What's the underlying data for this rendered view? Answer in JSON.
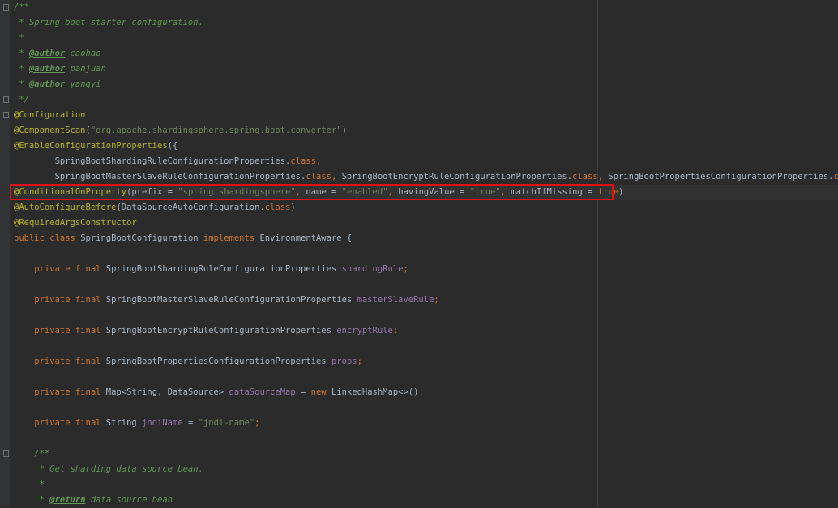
{
  "editor": {
    "lines": [
      {
        "tokens": [
          {
            "t": "/**",
            "k": "c"
          }
        ]
      },
      {
        "tokens": [
          {
            "t": " * Spring boot starter configuration.",
            "k": "c"
          }
        ]
      },
      {
        "tokens": [
          {
            "t": " *",
            "k": "c"
          }
        ]
      },
      {
        "tokens": [
          {
            "t": " * ",
            "k": "c"
          },
          {
            "t": "@author",
            "k": "tag"
          },
          {
            "t": " caohao",
            "k": "c"
          }
        ]
      },
      {
        "tokens": [
          {
            "t": " * ",
            "k": "c"
          },
          {
            "t": "@author",
            "k": "tag"
          },
          {
            "t": " panjuan",
            "k": "c"
          }
        ]
      },
      {
        "tokens": [
          {
            "t": " * ",
            "k": "c"
          },
          {
            "t": "@author",
            "k": "tag"
          },
          {
            "t": " yangyi",
            "k": "c"
          }
        ]
      },
      {
        "tokens": [
          {
            "t": " */",
            "k": "c"
          }
        ]
      },
      {
        "tokens": [
          {
            "t": "@Configuration",
            "k": "ann"
          }
        ]
      },
      {
        "tokens": [
          {
            "t": "@ComponentScan",
            "k": "ann"
          },
          {
            "t": "(",
            "k": "pl"
          },
          {
            "t": "\"org.apache.shardingsphere.spring.boot.converter\"",
            "k": "str"
          },
          {
            "t": ")",
            "k": "pl"
          }
        ]
      },
      {
        "tokens": [
          {
            "t": "@EnableConfigurationProperties",
            "k": "ann"
          },
          {
            "t": "({",
            "k": "pl"
          }
        ]
      },
      {
        "tokens": [
          {
            "t": "        SpringBootShardingRuleConfigurationProperties.",
            "k": "pl"
          },
          {
            "t": "class",
            "k": "kw"
          },
          {
            "t": ",",
            "k": "kw"
          }
        ]
      },
      {
        "tokens": [
          {
            "t": "        SpringBootMasterSlaveRuleConfigurationProperties.",
            "k": "pl"
          },
          {
            "t": "class",
            "k": "kw"
          },
          {
            "t": ", ",
            "k": "kw"
          },
          {
            "t": "SpringBootEncryptRuleConfigurationProperties.",
            "k": "pl"
          },
          {
            "t": "class",
            "k": "kw"
          },
          {
            "t": ", ",
            "k": "kw"
          },
          {
            "t": "SpringBootPropertiesConfigurationProperties.",
            "k": "pl"
          },
          {
            "t": "class",
            "k": "kw"
          },
          {
            "t": "})",
            "k": "pl"
          }
        ]
      },
      {
        "tokens": [
          {
            "t": "@ConditionalOnProperty",
            "k": "ann"
          },
          {
            "t": "(prefix = ",
            "k": "pl"
          },
          {
            "t": "\"spring.shardingsphere\"",
            "k": "str"
          },
          {
            "t": ", ",
            "k": "kw"
          },
          {
            "t": "name = ",
            "k": "pl"
          },
          {
            "t": "\"enabled\"",
            "k": "str"
          },
          {
            "t": ", ",
            "k": "kw"
          },
          {
            "t": "havingValue = ",
            "k": "pl"
          },
          {
            "t": "\"true\"",
            "k": "str"
          },
          {
            "t": ", ",
            "k": "kw"
          },
          {
            "t": "matchIfMissing = ",
            "k": "pl"
          },
          {
            "t": "true",
            "k": "kw"
          },
          {
            "t": ")",
            "k": "pl"
          }
        ]
      },
      {
        "tokens": [
          {
            "t": "@AutoConfigureBefore",
            "k": "ann"
          },
          {
            "t": "(DataSourceAutoConfiguration.",
            "k": "pl"
          },
          {
            "t": "class",
            "k": "kw"
          },
          {
            "t": ")",
            "k": "pl"
          }
        ]
      },
      {
        "tokens": [
          {
            "t": "@RequiredArgsConstructor",
            "k": "ann"
          }
        ]
      },
      {
        "tokens": [
          {
            "t": "public class ",
            "k": "kw"
          },
          {
            "t": "SpringBootConfiguration ",
            "k": "pl"
          },
          {
            "t": "implements ",
            "k": "kw"
          },
          {
            "t": "EnvironmentAware {",
            "k": "pl"
          }
        ]
      },
      {
        "tokens": []
      },
      {
        "tokens": [
          {
            "t": "    private final ",
            "k": "kw"
          },
          {
            "t": "SpringBootShardingRuleConfigurationProperties ",
            "k": "pl"
          },
          {
            "t": "shardingRule",
            "k": "fld"
          },
          {
            "t": ";",
            "k": "kw"
          }
        ]
      },
      {
        "tokens": []
      },
      {
        "tokens": [
          {
            "t": "    private final ",
            "k": "kw"
          },
          {
            "t": "SpringBootMasterSlaveRuleConfigurationProperties ",
            "k": "pl"
          },
          {
            "t": "masterSlaveRule",
            "k": "fld"
          },
          {
            "t": ";",
            "k": "kw"
          }
        ]
      },
      {
        "tokens": []
      },
      {
        "tokens": [
          {
            "t": "    private final ",
            "k": "kw"
          },
          {
            "t": "SpringBootEncryptRuleConfigurationProperties ",
            "k": "pl"
          },
          {
            "t": "encryptRule",
            "k": "fld"
          },
          {
            "t": ";",
            "k": "kw"
          }
        ]
      },
      {
        "tokens": []
      },
      {
        "tokens": [
          {
            "t": "    private final ",
            "k": "kw"
          },
          {
            "t": "SpringBootPropertiesConfigurationProperties ",
            "k": "pl"
          },
          {
            "t": "props",
            "k": "fld"
          },
          {
            "t": ";",
            "k": "kw"
          }
        ]
      },
      {
        "tokens": []
      },
      {
        "tokens": [
          {
            "t": "    private final ",
            "k": "kw"
          },
          {
            "t": "Map<String, DataSource> ",
            "k": "pl"
          },
          {
            "t": "dataSourceMap",
            "k": "fld"
          },
          {
            "t": " = ",
            "k": "pl"
          },
          {
            "t": "new ",
            "k": "kw"
          },
          {
            "t": "LinkedHashMap<>()",
            "k": "pl"
          },
          {
            "t": ";",
            "k": "kw"
          }
        ]
      },
      {
        "tokens": []
      },
      {
        "tokens": [
          {
            "t": "    private final ",
            "k": "kw"
          },
          {
            "t": "String ",
            "k": "pl"
          },
          {
            "t": "jndiName",
            "k": "fld"
          },
          {
            "t": " = ",
            "k": "pl"
          },
          {
            "t": "\"jndi-name\"",
            "k": "str"
          },
          {
            "t": ";",
            "k": "kw"
          }
        ]
      },
      {
        "tokens": []
      },
      {
        "tokens": [
          {
            "t": "    /**",
            "k": "c"
          }
        ]
      },
      {
        "tokens": [
          {
            "t": "     * Get sharding data source bean.",
            "k": "c"
          }
        ]
      },
      {
        "tokens": [
          {
            "t": "     *",
            "k": "c"
          }
        ]
      },
      {
        "tokens": [
          {
            "t": "     * ",
            "k": "c"
          },
          {
            "t": "@return",
            "k": "tag"
          },
          {
            "t": " data source bean",
            "k": "c"
          }
        ]
      }
    ],
    "highlighted_line": 12,
    "caret_line": 12,
    "fold_markers": [
      0,
      6,
      7,
      29
    ]
  },
  "colors": {
    "background": "#2b2b2b",
    "comment": "#629755",
    "annotation": "#bbb529",
    "string": "#6a8759",
    "keyword": "#cc7832",
    "field": "#9876aa",
    "plain": "#a9b7c6",
    "highlight_box": "#e01010"
  }
}
